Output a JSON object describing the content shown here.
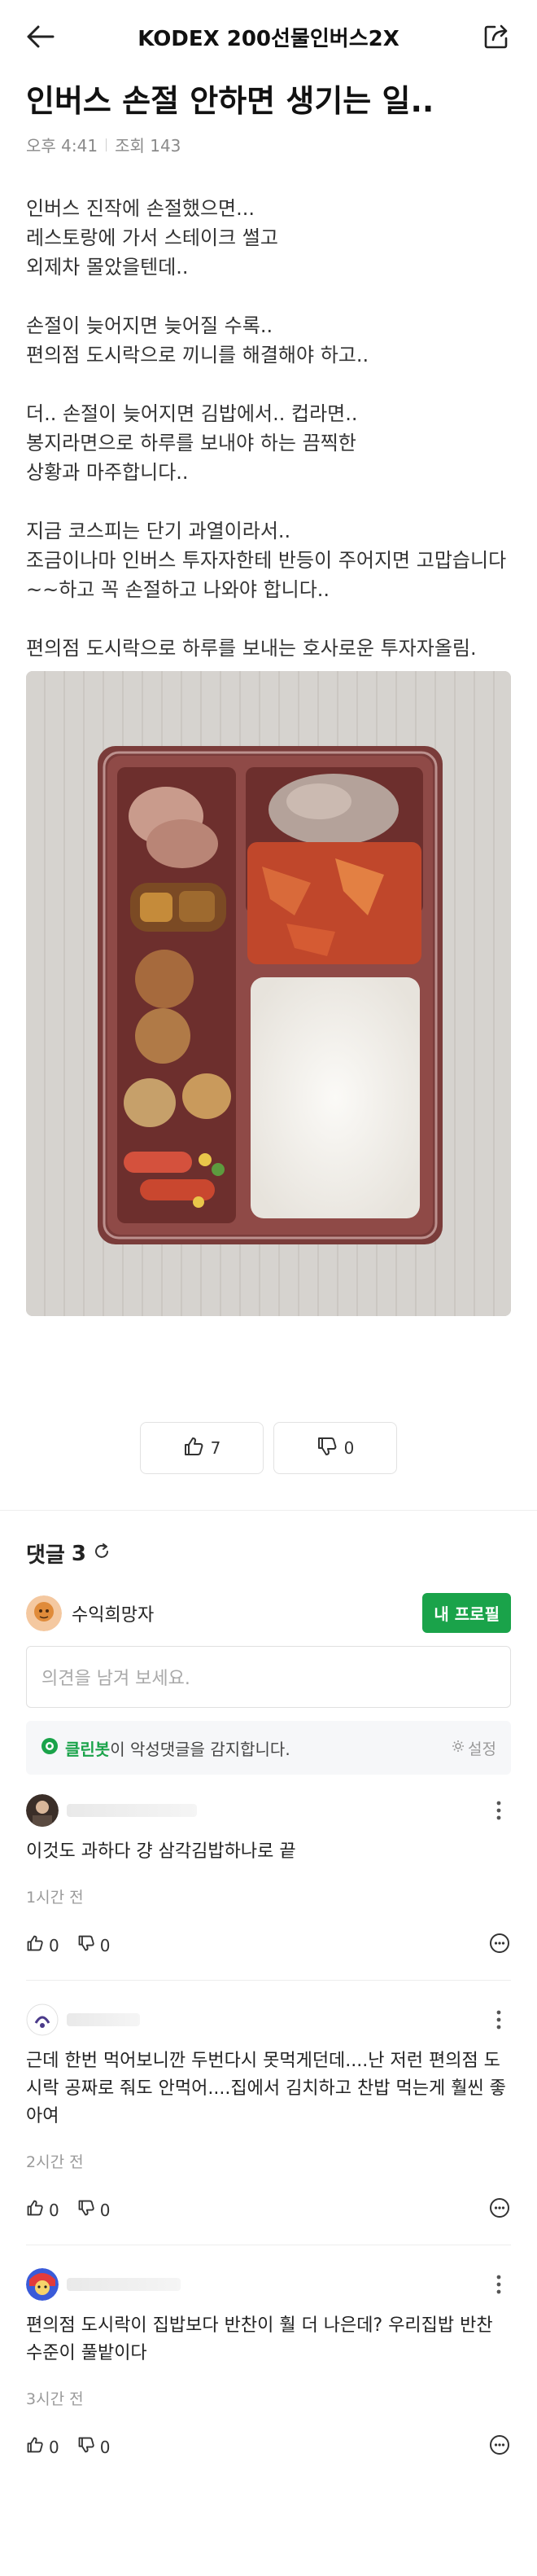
{
  "header": {
    "title": "KODEX 200선물인버스2X",
    "back_icon": "arrow-left-icon",
    "share_icon": "share-icon"
  },
  "post": {
    "title": "인버스 손절 안하면 생기는 일..",
    "time": "오후 4:41",
    "views": "조회 143",
    "paragraphs": [
      "인버스 진작에 손절했으면...\n레스토랑에 가서 스테이크 썰고\n외제차 몰았을텐데..",
      "손절이 늦어지면 늦어질 수록..\n편의점 도시락으로 끼니를 해결해야 하고..",
      "더.. 손절이 늦어지면 김밥에서.. 컵라면..\n봉지라면으로 하루를 보내야 하는 끔찍한\n상황과 마주합니다..",
      "지금 코스피는 단기 과열이라서..\n조금이나마 인버스 투자자한테  반등이 주어지면 고맙습니다~~하고 꼭 손절하고 나와야 합니다..",
      "편의점 도시락으로 하루를 보내는 호사로운 투자자올림."
    ],
    "like_count": "7",
    "dislike_count": "0"
  },
  "comments_section": {
    "title": "댓글",
    "count": "3",
    "my_name": "수익희망자",
    "profile_button": "내 프로필",
    "input_placeholder": "의견을 남겨 보세요.",
    "cleanbot_name": "클린봇",
    "cleanbot_text": "이 악성댓글을 감지합니다.",
    "cleanbot_settings": "설정"
  },
  "comments": [
    {
      "text": "이것도 과하다 걍 삼각김밥하나로 끝",
      "time": "1시간 전",
      "likes": "0",
      "dislikes": "0"
    },
    {
      "text": "근데 한번 먹어보니깐 두번다시 못먹게던데....난 저런 편의점 도시락 공짜로 줘도 안먹어....집에서 김치하고 찬밥 먹는게 훨씬 좋아여",
      "time": "2시간 전",
      "likes": "0",
      "dislikes": "0"
    },
    {
      "text": "편의점 도시락이 집밥보다 반찬이 훨 더 나은데? 우리집밥 반찬 수준이 풀밭이다",
      "time": "3시간 전",
      "likes": "0",
      "dislikes": "0"
    }
  ],
  "colors": {
    "accent_green": "#1aa34a",
    "text": "#222222",
    "muted": "#8a8a8a"
  }
}
